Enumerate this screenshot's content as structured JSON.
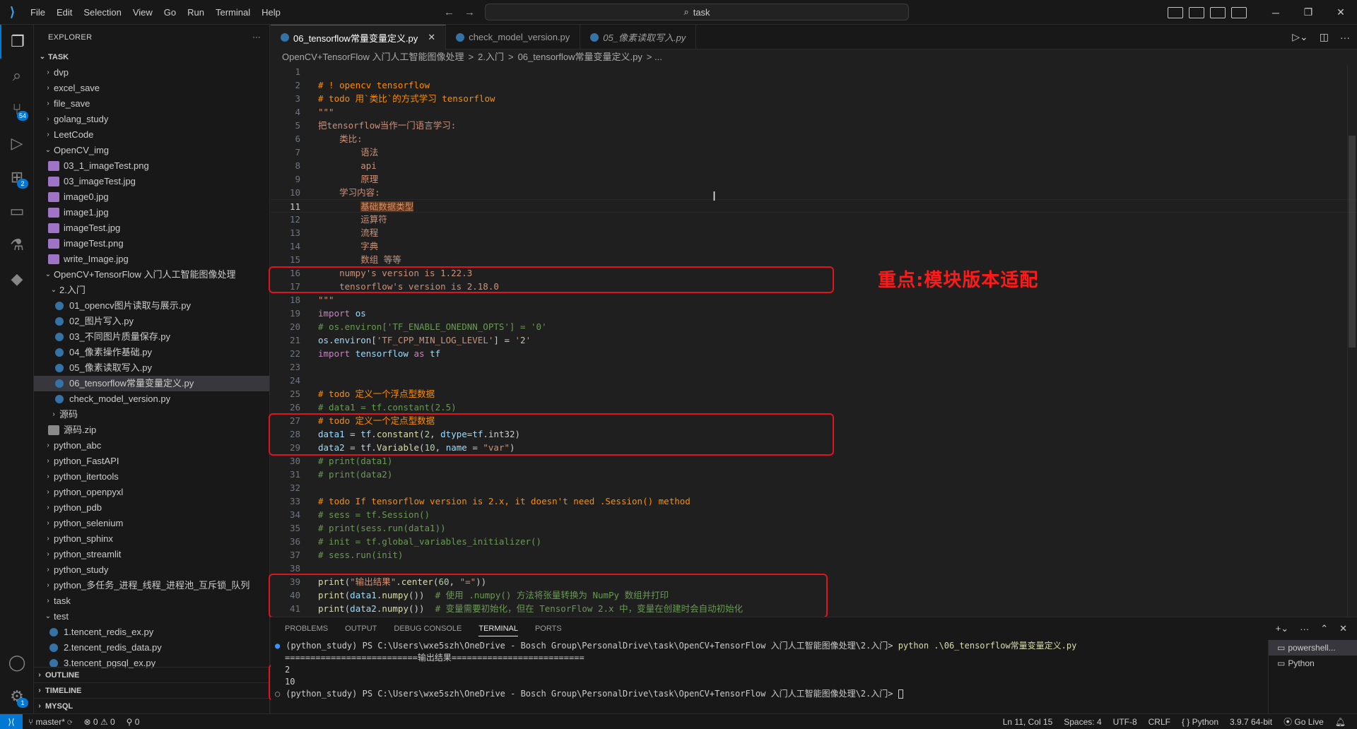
{
  "titlebar": {
    "menu": [
      "File",
      "Edit",
      "Selection",
      "View",
      "Go",
      "Run",
      "Terminal",
      "Help"
    ],
    "search": "task"
  },
  "activity": {
    "scm_badge": "54",
    "extensions_badge": "2",
    "settings_badge": "1"
  },
  "sidebar": {
    "title": "EXPLORER",
    "root": "TASK",
    "items": [
      {
        "label": "dvp",
        "type": "folder",
        "indent": 0,
        "open": false
      },
      {
        "label": "excel_save",
        "type": "folder",
        "indent": 0,
        "open": false
      },
      {
        "label": "file_save",
        "type": "folder",
        "indent": 0,
        "open": false
      },
      {
        "label": "golang_study",
        "type": "folder",
        "indent": 0,
        "open": false
      },
      {
        "label": "LeetCode",
        "type": "folder",
        "indent": 0,
        "open": false
      },
      {
        "label": "OpenCV_img",
        "type": "folder",
        "indent": 0,
        "open": true
      },
      {
        "label": "03_1_imageTest.png",
        "type": "img",
        "indent": 1
      },
      {
        "label": "03_imageTest.jpg",
        "type": "img",
        "indent": 1
      },
      {
        "label": "image0.jpg",
        "type": "img",
        "indent": 1
      },
      {
        "label": "image1.jpg",
        "type": "img",
        "indent": 1
      },
      {
        "label": "imageTest.jpg",
        "type": "img",
        "indent": 1
      },
      {
        "label": "imageTest.png",
        "type": "img",
        "indent": 1
      },
      {
        "label": "write_Image.jpg",
        "type": "img",
        "indent": 1
      },
      {
        "label": "OpenCV+TensorFlow 入门人工智能图像处理",
        "type": "folder",
        "indent": 0,
        "open": true
      },
      {
        "label": "2.入门",
        "type": "folder",
        "indent": 1,
        "open": true
      },
      {
        "label": "01_opencv图片读取与展示.py",
        "type": "py",
        "indent": 2
      },
      {
        "label": "02_图片写入.py",
        "type": "py",
        "indent": 2
      },
      {
        "label": "03_不同图片质量保存.py",
        "type": "py",
        "indent": 2
      },
      {
        "label": "04_像素操作基础.py",
        "type": "py",
        "indent": 2
      },
      {
        "label": "05_像素读取写入.py",
        "type": "py",
        "indent": 2
      },
      {
        "label": "06_tensorflow常量变量定义.py",
        "type": "py",
        "indent": 2,
        "selected": true
      },
      {
        "label": "check_model_version.py",
        "type": "py",
        "indent": 2
      },
      {
        "label": "源码",
        "type": "folder",
        "indent": 1,
        "open": false
      },
      {
        "label": "源码.zip",
        "type": "zip",
        "indent": 1
      },
      {
        "label": "python_abc",
        "type": "folder",
        "indent": 0,
        "open": false
      },
      {
        "label": "python_FastAPI",
        "type": "folder",
        "indent": 0,
        "open": false
      },
      {
        "label": "python_itertools",
        "type": "folder",
        "indent": 0,
        "open": false
      },
      {
        "label": "python_openpyxl",
        "type": "folder",
        "indent": 0,
        "open": false
      },
      {
        "label": "python_pdb",
        "type": "folder",
        "indent": 0,
        "open": false
      },
      {
        "label": "python_selenium",
        "type": "folder",
        "indent": 0,
        "open": false
      },
      {
        "label": "python_sphinx",
        "type": "folder",
        "indent": 0,
        "open": false
      },
      {
        "label": "python_streamlit",
        "type": "folder",
        "indent": 0,
        "open": false
      },
      {
        "label": "python_study",
        "type": "folder",
        "indent": 0,
        "open": false
      },
      {
        "label": "python_多任务_进程_线程_进程池_互斥锁_队列",
        "type": "folder",
        "indent": 0,
        "open": false
      },
      {
        "label": "task",
        "type": "folder",
        "indent": 0,
        "open": false
      },
      {
        "label": "test",
        "type": "folder",
        "indent": 0,
        "open": true
      },
      {
        "label": "1.tencent_redis_ex.py",
        "type": "py",
        "indent": 1
      },
      {
        "label": "2.tencent_redis_data.py",
        "type": "py",
        "indent": 1
      },
      {
        "label": "3.tencent_pgsql_ex.py",
        "type": "py",
        "indent": 1
      }
    ],
    "sections": [
      "OUTLINE",
      "TIMELINE",
      "MYSQL"
    ]
  },
  "tabs": [
    {
      "label": "06_tensorflow常量变量定义.py",
      "active": true
    },
    {
      "label": "check_model_version.py",
      "active": false
    },
    {
      "label": "05_像素读取写入.py",
      "active": false,
      "italic": true
    }
  ],
  "breadcrumb": [
    "OpenCV+TensorFlow 入门人工智能图像处理",
    ">",
    "2.入门",
    ">",
    "06_tensorflow常量变量定义.py",
    "> ..."
  ],
  "code": [
    "",
    "# ! opencv tensorflow",
    "# todo 用`类比`的方式学习 tensorflow",
    "\"\"\"",
    "把tensorflow当作一门语言学习:",
    "    类比:",
    "        语法",
    "        api",
    "        原理",
    "    学习内容:",
    "        基础数据类型",
    "        运算符",
    "        流程",
    "        字典",
    "        数组 等等",
    "    numpy's version is 1.22.3",
    "    tensorflow's version is 2.18.0",
    "\"\"\"",
    "import os",
    "# os.environ['TF_ENABLE_ONEDNN_OPTS'] = '0'",
    "os.environ['TF_CPP_MIN_LOG_LEVEL'] = '2'",
    "import tensorflow as tf",
    "",
    "",
    "# todo 定义一个浮点型数据",
    "# data1 = tf.constant(2.5)",
    "# todo 定义一个定点型数据",
    "data1 = tf.constant(2, dtype=tf.int32)",
    "data2 = tf.Variable(10, name = \"var\")",
    "# print(data1)",
    "# print(data2)",
    "",
    "# todo If tensorflow version is 2.x, it doesn't need .Session() method",
    "# sess = tf.Session()",
    "# print(sess.run(data1))",
    "# init = tf.global_variables_initializer()",
    "# sess.run(init)",
    "",
    "print(\"输出结果\".center(60, \"=\"))",
    "print(data1.numpy())  # 使用 .numpy() 方法将张量转换为 NumPy 数组并打印",
    "print(data2.numpy())  # 变量需要初始化，但在 TensorFlow 2.x 中，变量在创建时会自动初始化"
  ],
  "current_line": 11,
  "annotation": "重点:模块版本适配",
  "panel": {
    "tabs": [
      "PROBLEMS",
      "OUTPUT",
      "DEBUG CONSOLE",
      "TERMINAL",
      "PORTS"
    ],
    "active_tab": "TERMINAL",
    "terminal": {
      "prompt1": "(python_study) PS C:\\Users\\wxe5szh\\OneDrive - Bosch Group\\PersonalDrive\\task\\OpenCV+TensorFlow 入门人工智能图像处理\\2.入门> ",
      "cmd": "python .\\06_tensorflow常量变量定义.py",
      "out1": "==========================输出结果==========================",
      "out2": "2",
      "out3": "10",
      "prompt2": "(python_study) PS C:\\Users\\wxe5szh\\OneDrive - Bosch Group\\PersonalDrive\\task\\OpenCV+TensorFlow 入门人工智能图像处理\\2.入门> "
    },
    "terminals": [
      "powershell...",
      "Python"
    ]
  },
  "status": {
    "branch": "master*",
    "errors": "0",
    "warnings": "0",
    "ports": "0",
    "position": "Ln 11, Col 15",
    "spaces": "Spaces: 4",
    "encoding": "UTF-8",
    "eol": "CRLF",
    "language": "Python",
    "interpreter": "3.9.7 64-bit",
    "golive": "Go Live"
  }
}
